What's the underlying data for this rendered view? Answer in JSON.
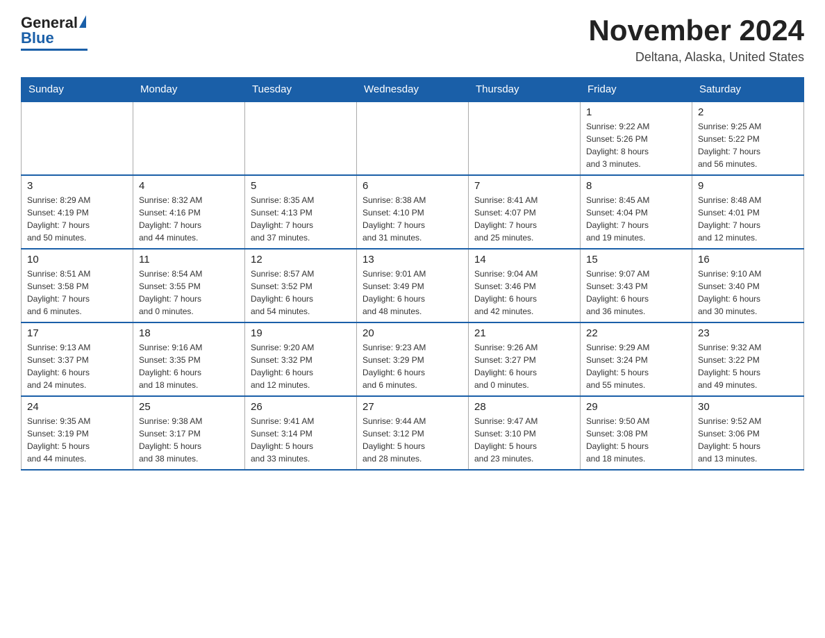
{
  "header": {
    "logo_general": "General",
    "logo_blue": "Blue",
    "month_title": "November 2024",
    "location": "Deltana, Alaska, United States"
  },
  "weekdays": [
    "Sunday",
    "Monday",
    "Tuesday",
    "Wednesday",
    "Thursday",
    "Friday",
    "Saturday"
  ],
  "weeks": [
    [
      {
        "day": "",
        "info": ""
      },
      {
        "day": "",
        "info": ""
      },
      {
        "day": "",
        "info": ""
      },
      {
        "day": "",
        "info": ""
      },
      {
        "day": "",
        "info": ""
      },
      {
        "day": "1",
        "info": "Sunrise: 9:22 AM\nSunset: 5:26 PM\nDaylight: 8 hours\nand 3 minutes."
      },
      {
        "day": "2",
        "info": "Sunrise: 9:25 AM\nSunset: 5:22 PM\nDaylight: 7 hours\nand 56 minutes."
      }
    ],
    [
      {
        "day": "3",
        "info": "Sunrise: 8:29 AM\nSunset: 4:19 PM\nDaylight: 7 hours\nand 50 minutes."
      },
      {
        "day": "4",
        "info": "Sunrise: 8:32 AM\nSunset: 4:16 PM\nDaylight: 7 hours\nand 44 minutes."
      },
      {
        "day": "5",
        "info": "Sunrise: 8:35 AM\nSunset: 4:13 PM\nDaylight: 7 hours\nand 37 minutes."
      },
      {
        "day": "6",
        "info": "Sunrise: 8:38 AM\nSunset: 4:10 PM\nDaylight: 7 hours\nand 31 minutes."
      },
      {
        "day": "7",
        "info": "Sunrise: 8:41 AM\nSunset: 4:07 PM\nDaylight: 7 hours\nand 25 minutes."
      },
      {
        "day": "8",
        "info": "Sunrise: 8:45 AM\nSunset: 4:04 PM\nDaylight: 7 hours\nand 19 minutes."
      },
      {
        "day": "9",
        "info": "Sunrise: 8:48 AM\nSunset: 4:01 PM\nDaylight: 7 hours\nand 12 minutes."
      }
    ],
    [
      {
        "day": "10",
        "info": "Sunrise: 8:51 AM\nSunset: 3:58 PM\nDaylight: 7 hours\nand 6 minutes."
      },
      {
        "day": "11",
        "info": "Sunrise: 8:54 AM\nSunset: 3:55 PM\nDaylight: 7 hours\nand 0 minutes."
      },
      {
        "day": "12",
        "info": "Sunrise: 8:57 AM\nSunset: 3:52 PM\nDaylight: 6 hours\nand 54 minutes."
      },
      {
        "day": "13",
        "info": "Sunrise: 9:01 AM\nSunset: 3:49 PM\nDaylight: 6 hours\nand 48 minutes."
      },
      {
        "day": "14",
        "info": "Sunrise: 9:04 AM\nSunset: 3:46 PM\nDaylight: 6 hours\nand 42 minutes."
      },
      {
        "day": "15",
        "info": "Sunrise: 9:07 AM\nSunset: 3:43 PM\nDaylight: 6 hours\nand 36 minutes."
      },
      {
        "day": "16",
        "info": "Sunrise: 9:10 AM\nSunset: 3:40 PM\nDaylight: 6 hours\nand 30 minutes."
      }
    ],
    [
      {
        "day": "17",
        "info": "Sunrise: 9:13 AM\nSunset: 3:37 PM\nDaylight: 6 hours\nand 24 minutes."
      },
      {
        "day": "18",
        "info": "Sunrise: 9:16 AM\nSunset: 3:35 PM\nDaylight: 6 hours\nand 18 minutes."
      },
      {
        "day": "19",
        "info": "Sunrise: 9:20 AM\nSunset: 3:32 PM\nDaylight: 6 hours\nand 12 minutes."
      },
      {
        "day": "20",
        "info": "Sunrise: 9:23 AM\nSunset: 3:29 PM\nDaylight: 6 hours\nand 6 minutes."
      },
      {
        "day": "21",
        "info": "Sunrise: 9:26 AM\nSunset: 3:27 PM\nDaylight: 6 hours\nand 0 minutes."
      },
      {
        "day": "22",
        "info": "Sunrise: 9:29 AM\nSunset: 3:24 PM\nDaylight: 5 hours\nand 55 minutes."
      },
      {
        "day": "23",
        "info": "Sunrise: 9:32 AM\nSunset: 3:22 PM\nDaylight: 5 hours\nand 49 minutes."
      }
    ],
    [
      {
        "day": "24",
        "info": "Sunrise: 9:35 AM\nSunset: 3:19 PM\nDaylight: 5 hours\nand 44 minutes."
      },
      {
        "day": "25",
        "info": "Sunrise: 9:38 AM\nSunset: 3:17 PM\nDaylight: 5 hours\nand 38 minutes."
      },
      {
        "day": "26",
        "info": "Sunrise: 9:41 AM\nSunset: 3:14 PM\nDaylight: 5 hours\nand 33 minutes."
      },
      {
        "day": "27",
        "info": "Sunrise: 9:44 AM\nSunset: 3:12 PM\nDaylight: 5 hours\nand 28 minutes."
      },
      {
        "day": "28",
        "info": "Sunrise: 9:47 AM\nSunset: 3:10 PM\nDaylight: 5 hours\nand 23 minutes."
      },
      {
        "day": "29",
        "info": "Sunrise: 9:50 AM\nSunset: 3:08 PM\nDaylight: 5 hours\nand 18 minutes."
      },
      {
        "day": "30",
        "info": "Sunrise: 9:52 AM\nSunset: 3:06 PM\nDaylight: 5 hours\nand 13 minutes."
      }
    ]
  ]
}
